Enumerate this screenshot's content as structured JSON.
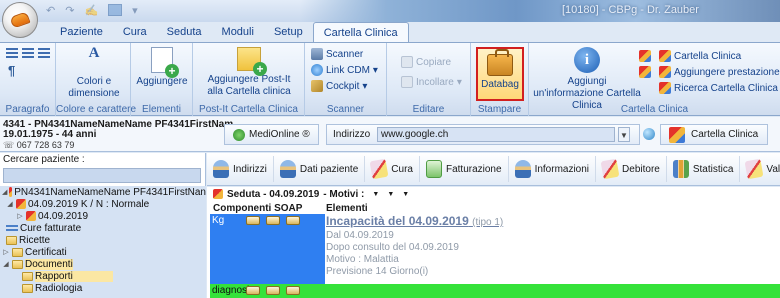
{
  "window": {
    "title": "[10180] - CBPg - Dr. Zauber"
  },
  "ribbon_tabs": [
    "Paziente",
    "Cura",
    "Seduta",
    "Moduli",
    "Setup",
    "Cartella Clinica"
  ],
  "ribbon_active_tab": "Cartella Clinica",
  "ribbon": {
    "paragrafo": {
      "label": "Paragrafo"
    },
    "colore": {
      "button": "Colori e dimensione",
      "label": "Colore e carattere"
    },
    "elementi": {
      "button": "Aggiungere",
      "label": "Elementi"
    },
    "postit": {
      "button": "Aggiungere Post-It alla Cartella clinica",
      "label": "Post-It Cartella Clinica"
    },
    "scanner": {
      "items": [
        "Scanner",
        "Link CDM",
        "Cockpit"
      ],
      "label": "Scanner"
    },
    "editare": {
      "items": [
        "Copiare",
        "Incollare"
      ],
      "label": "Editare"
    },
    "stampare": {
      "button": "Databag",
      "label": "Stampare"
    },
    "cartella": {
      "info_button": "Aggiungi un'informazione Cartella Clinica",
      "items": [
        "Cartella Clinica",
        "Aggiungere prestazione",
        "Ricerca Cartella Clinica"
      ],
      "label": "Cartella Clinica"
    }
  },
  "patient": {
    "line1": "4341 - PN4341NameNameName PF4341FirstNam",
    "line2": "19.01.1975 - 44 anni",
    "phone": "067 728 63 79"
  },
  "header_buttons": {
    "medionline": "MediOnline ®",
    "address_label": "Indirizzo",
    "address_value": "www.google.ch",
    "cartella_clinica": "Cartella Clinica"
  },
  "search": {
    "label": "Cercare paziente :",
    "value": ""
  },
  "tree": [
    {
      "text": "PN4341NameNameName PF4341FirstNan",
      "indent": 0,
      "icon": "patient"
    },
    {
      "text": "04.09.2019 K / N : Normale",
      "indent": 1,
      "icon": "calendar"
    },
    {
      "text": "04.09.2019",
      "indent": 2,
      "icon": "calendar"
    },
    {
      "text": "Cure fatturate",
      "indent": 1,
      "icon": "list"
    },
    {
      "text": "Ricette",
      "indent": 1,
      "icon": "folder"
    },
    {
      "text": "Certificati",
      "indent": 1,
      "icon": "folder"
    },
    {
      "text": "Documenti",
      "indent": 1,
      "icon": "folder",
      "selected": true
    },
    {
      "text": "Rapporti",
      "indent": 2,
      "icon": "folder",
      "selected": true
    },
    {
      "text": "Radiologia",
      "indent": 2,
      "icon": "folder"
    }
  ],
  "toolbar": [
    "Indirizzi",
    "Dati paziente",
    "Cura",
    "Fatturazione",
    "Informazioni",
    "Debitore",
    "Statistica",
    "Valori"
  ],
  "main": {
    "seduta": "Seduta - 04.09.2019",
    "motivi": "- Motivi :",
    "col_soap": "Componenti SOAP",
    "col_elements": "Elementi",
    "soap_kg": "Kg",
    "diag_label": "diagnosi",
    "element_title": "Incapacità del 04.09.2019",
    "element_tipo": "(tipo 1)",
    "element_lines": [
      "Dal 04.09.2019",
      "Dopo consulto del 04.09.2019",
      "Motivo : Malattia",
      "Previsione 14 Giorno(i)"
    ]
  }
}
